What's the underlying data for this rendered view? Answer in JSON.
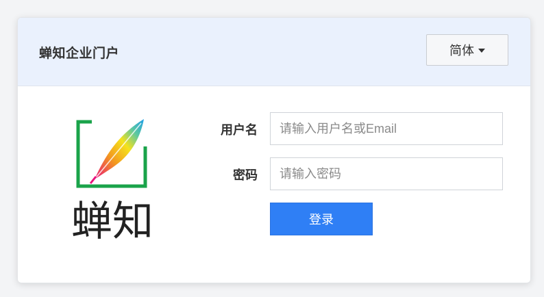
{
  "header": {
    "title": "蝉知企业门户",
    "language_button": "简体"
  },
  "logo": {
    "text": "蝉知",
    "icon": "feather-quill-logo"
  },
  "form": {
    "username_label": "用户名",
    "username_placeholder": "请输入用户名或Email",
    "password_label": "密码",
    "password_placeholder": "请输入密码",
    "login_button": "登录"
  },
  "colors": {
    "header_bg": "#eaf1fd",
    "primary": "#2f7ff5",
    "logo_frame": "#1aa34a"
  }
}
